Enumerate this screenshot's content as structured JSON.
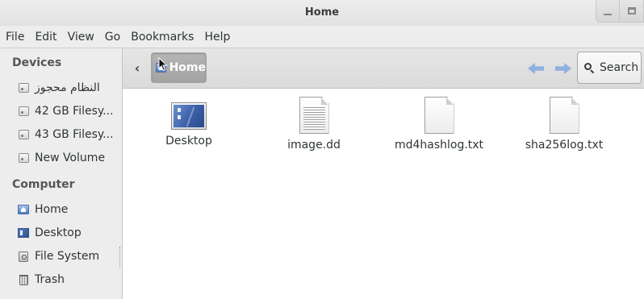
{
  "window": {
    "title": "Home",
    "minimize_icon": "minimize-icon",
    "maximize_icon": "maximize-icon"
  },
  "menubar": [
    "File",
    "Edit",
    "View",
    "Go",
    "Bookmarks",
    "Help"
  ],
  "sidebar": {
    "devices_heading": "Devices",
    "devices": [
      {
        "label": "النظام محجوز",
        "icon": "drive-icon"
      },
      {
        "label": "42 GB Filesy...",
        "icon": "drive-icon"
      },
      {
        "label": "43 GB Filesy...",
        "icon": "drive-icon"
      },
      {
        "label": "New Volume",
        "icon": "drive-icon"
      }
    ],
    "computer_heading": "Computer",
    "computer": [
      {
        "label": "Home",
        "icon": "home-folder-icon"
      },
      {
        "label": "Desktop",
        "icon": "desktop-icon"
      },
      {
        "label": "File System",
        "icon": "filesystem-icon"
      },
      {
        "label": "Trash",
        "icon": "trash-icon"
      }
    ]
  },
  "toolbar": {
    "location": "Home",
    "search_label": "Search"
  },
  "files": [
    {
      "name": "Desktop",
      "icon": "desktop-folder-icon"
    },
    {
      "name": "image.dd",
      "icon": "text-document-icon"
    },
    {
      "name": "md4hashlog.txt",
      "icon": "blank-document-icon"
    },
    {
      "name": "sha256log.txt",
      "icon": "blank-document-icon"
    }
  ],
  "colors": {
    "chrome": "#ededed",
    "path_button": "#a9a9a9",
    "nav_arrow": "#8fb1df",
    "content_bg": "#ffffff"
  }
}
